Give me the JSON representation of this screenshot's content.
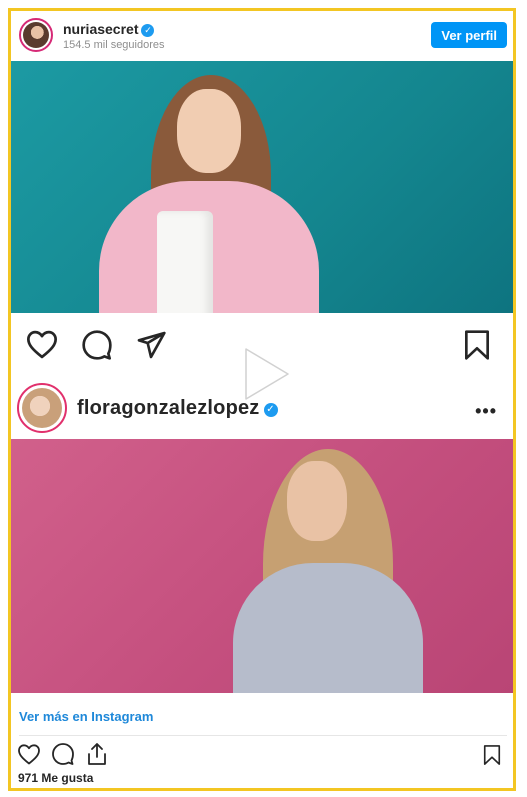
{
  "header": {
    "username": "nuriasecret",
    "followers": "154.5 mil seguidores",
    "view_profile_label": "Ver perfil"
  },
  "post2": {
    "username": "floragonzalezlopez",
    "more_label": "•••"
  },
  "footer": {
    "see_more_label": "Ver más en Instagram",
    "likes": "971 Me gusta"
  },
  "icons": [
    "heart-icon",
    "comment-icon",
    "send-icon",
    "bookmark-icon",
    "play-icon",
    "share-icon",
    "verified-icon",
    "more-icon"
  ],
  "colors": {
    "frame_border": "#f3c623",
    "button_blue": "#0095f6",
    "link_blue": "#1e88d9",
    "teal_background": "#1c9aa3",
    "pink_background": "#d1608b"
  }
}
